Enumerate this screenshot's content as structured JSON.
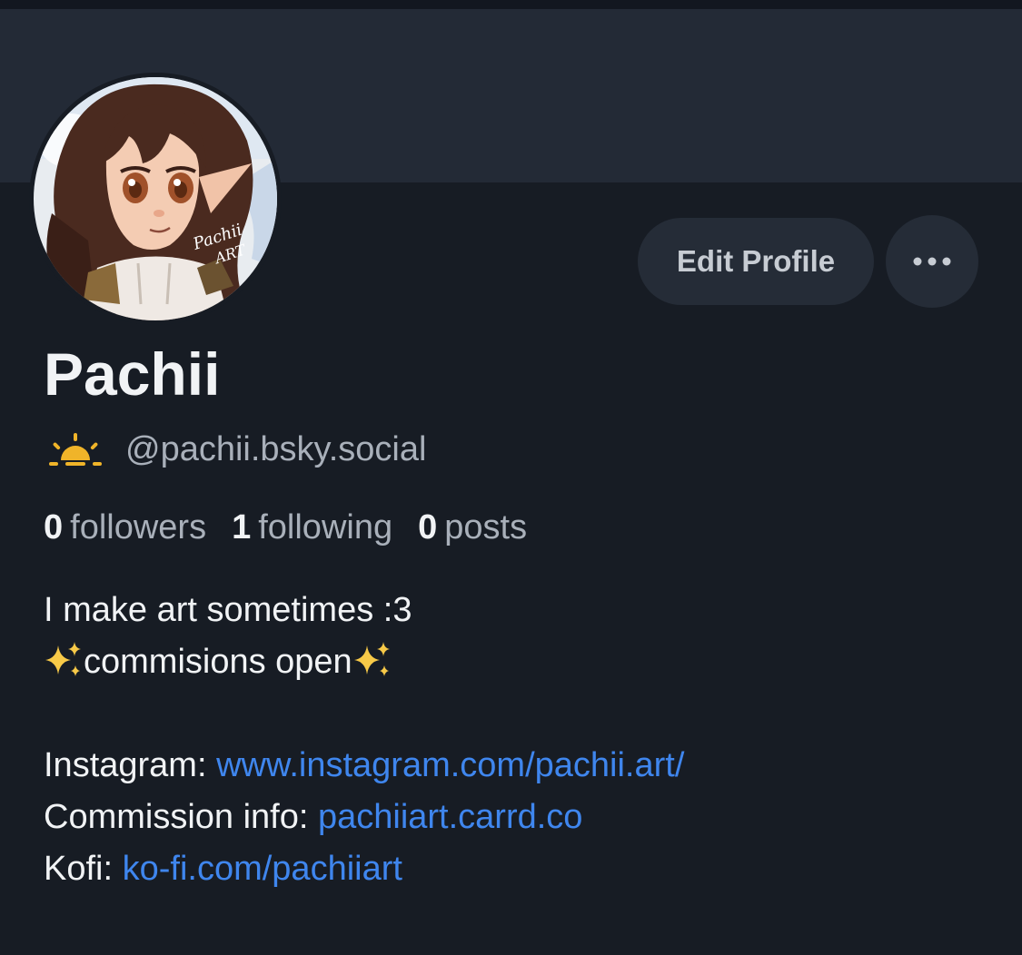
{
  "profile": {
    "display_name": "Pachii",
    "handle": "@pachii.bsky.social",
    "handle_icon": "sunrise-icon",
    "avatar_text": "Pachii ART"
  },
  "actions": {
    "edit_profile_label": "Edit Profile",
    "more_icon": "more-horizontal-icon"
  },
  "stats": [
    {
      "count": "0",
      "label": "followers"
    },
    {
      "count": "1",
      "label": "following"
    },
    {
      "count": "0",
      "label": "posts"
    }
  ],
  "bio": {
    "line1": "I make art sometimes :3",
    "line2": "commisions open",
    "sparkle_icon": "sparkles-icon",
    "links": [
      {
        "label": "Instagram:",
        "url_text": "www.instagram.com/pachii.art/"
      },
      {
        "label": "Commission info:",
        "url_text": "pachiiart.carrd.co"
      },
      {
        "label": "Kofi:",
        "url_text": "ko-fi.com/pachiiart"
      }
    ]
  },
  "colors": {
    "background": "#171c24",
    "banner": "#232a36",
    "button": "#252c37",
    "link": "#3f86ee",
    "muted_text": "#a9b0ba",
    "accent_icon": "#f0b429"
  }
}
